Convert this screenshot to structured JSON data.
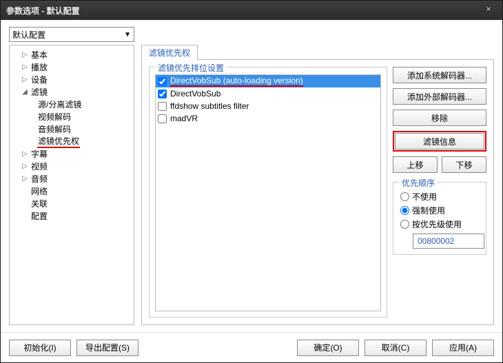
{
  "window": {
    "title": "参数选项 - 默认配置",
    "close": "×"
  },
  "profile": {
    "value": "默认配置"
  },
  "tree": {
    "basic": "基本",
    "play": "播放",
    "device": "设备",
    "filter": "滤镜",
    "filter_children": {
      "source": "源/分离滤镜",
      "videodec": "视频解码",
      "audiodec": "音频解码",
      "priority": "滤镜优先权"
    },
    "subtitle": "字幕",
    "video": "视频",
    "audio": "音频",
    "network": "网络",
    "assoc": "关联",
    "config": "配置"
  },
  "tab": {
    "label": "滤镜优先权"
  },
  "filters": {
    "legend": "滤镜优先排位设置",
    "items": [
      {
        "name": "DirectVobSub (auto-loading version)",
        "checked": true,
        "selected": true,
        "underline": true
      },
      {
        "name": "DirectVobSub",
        "checked": true,
        "selected": false,
        "underline": false
      },
      {
        "name": "ffdshow subtitles filter",
        "checked": false,
        "selected": false,
        "underline": false
      },
      {
        "name": "madVR",
        "checked": false,
        "selected": false,
        "underline": false
      }
    ]
  },
  "buttons": {
    "add_sys": "添加系统解码器...",
    "add_ext": "添加外部解码器...",
    "remove": "移除",
    "info": "滤镜信息",
    "up": "上移",
    "down": "下移"
  },
  "priority": {
    "legend": "优先顺序",
    "r_none": "不使用",
    "r_force": "强制使用",
    "r_by": "按优先级使用",
    "value": "00800002"
  },
  "footer": {
    "init": "初始化(I)",
    "export": "导出配置(S)",
    "ok": "确定(O)",
    "cancel": "取消(C)",
    "apply": "应用(A)"
  }
}
